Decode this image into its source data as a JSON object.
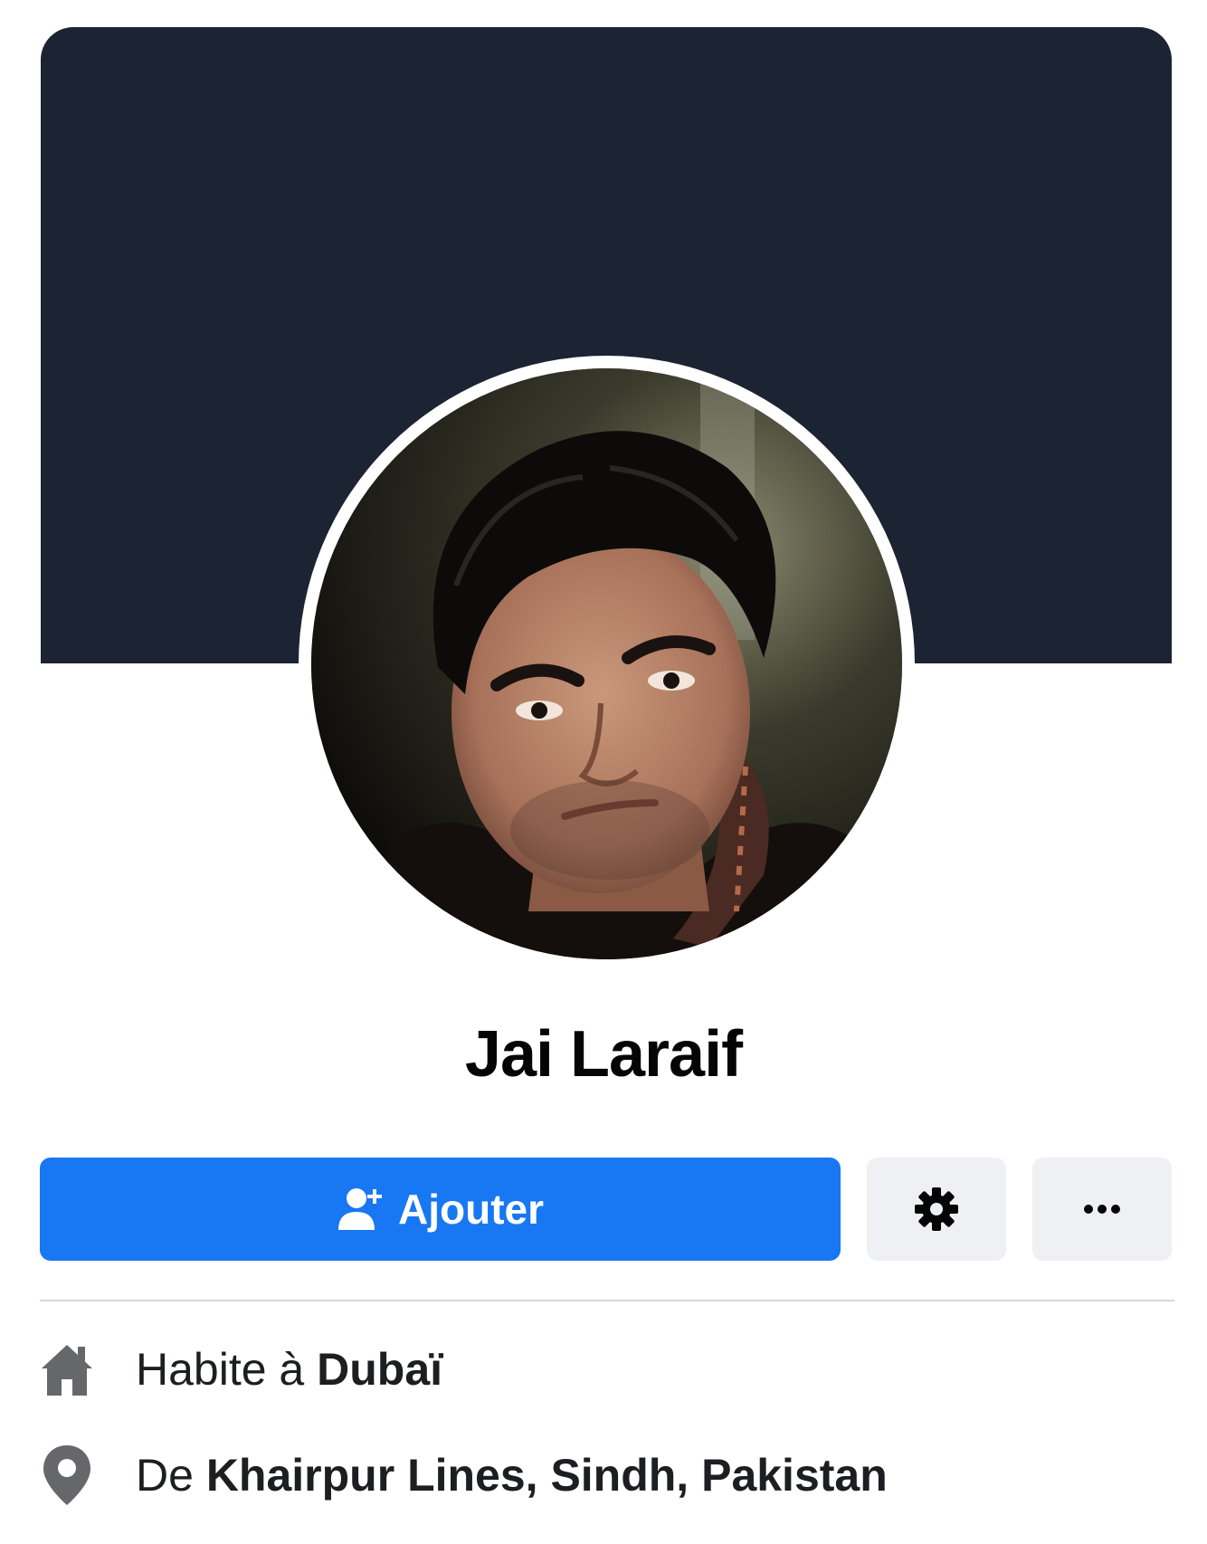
{
  "profile": {
    "name": "Jai Laraif"
  },
  "actions": {
    "add_label": "Ajouter",
    "settings_icon": "gear-icon",
    "more_icon": "more-dots-icon"
  },
  "intro": {
    "lives_prefix": "Habite à",
    "lives_place": "Dubaï",
    "from_prefix": "De",
    "from_place": "Khairpur Lines, Sindh, Pakistan"
  },
  "colors": {
    "cover": "#1c2332",
    "primary_button": "#1877f2",
    "secondary_button": "#eef0f3",
    "icon_gray": "#65676b"
  }
}
